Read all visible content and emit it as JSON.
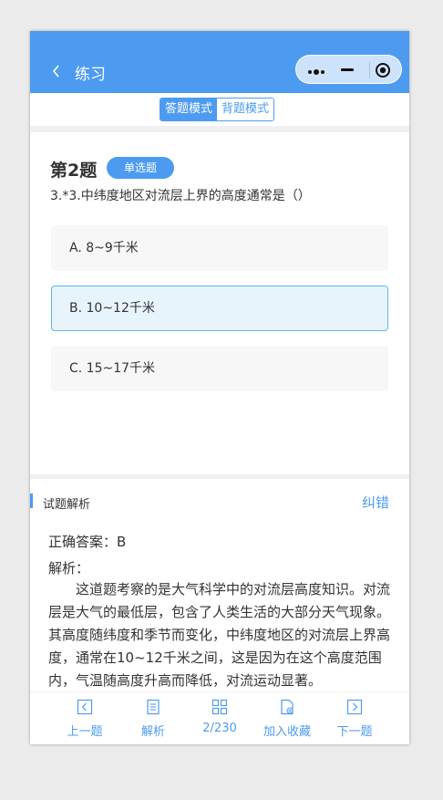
{
  "header": {
    "title": "练习"
  },
  "modes": {
    "answer": "答题模式",
    "recite": "背题模式"
  },
  "question": {
    "number": "第2题",
    "type": "单选题",
    "text": "3.*3.中纬度地区对流层上界的高度通常是（）",
    "options": [
      {
        "label": "A. 8~9千米",
        "selected": false
      },
      {
        "label": "B. 10~12千米",
        "selected": true
      },
      {
        "label": "C. 15~17千米",
        "selected": false
      }
    ]
  },
  "analysis": {
    "title": "试题解析",
    "report": "纠错",
    "correct_answer": "正确答案：B",
    "label": "解析：",
    "body": "这道题考察的是大气科学中的对流层高度知识。对流层是大气的最低层，包含了人类生活的大部分天气现象。其高度随纬度和季节而变化，中纬度地区的对流层上界高度，通常在10~12千米之间，这是因为在这个高度范围内，气温随高度升高而降低，对流运动显著。"
  },
  "bottom_bar": {
    "prev": "上一题",
    "explain": "解析",
    "progress": "2/230",
    "favorite": "加入收藏",
    "next": "下一题"
  },
  "icons": {
    "back": "chevron-left-icon",
    "more": "more-dots-icon",
    "minimize": "minimize-icon",
    "close": "target-close-icon",
    "prev": "chevron-left-box-icon",
    "explain": "document-icon",
    "progress": "grid-icon",
    "favorite": "bookmark-add-icon",
    "next": "chevron-right-box-icon"
  },
  "colors": {
    "accent": "#4d9bf0",
    "selected_bg": "#e8f4fc",
    "selected_border": "#5cb8e6"
  }
}
